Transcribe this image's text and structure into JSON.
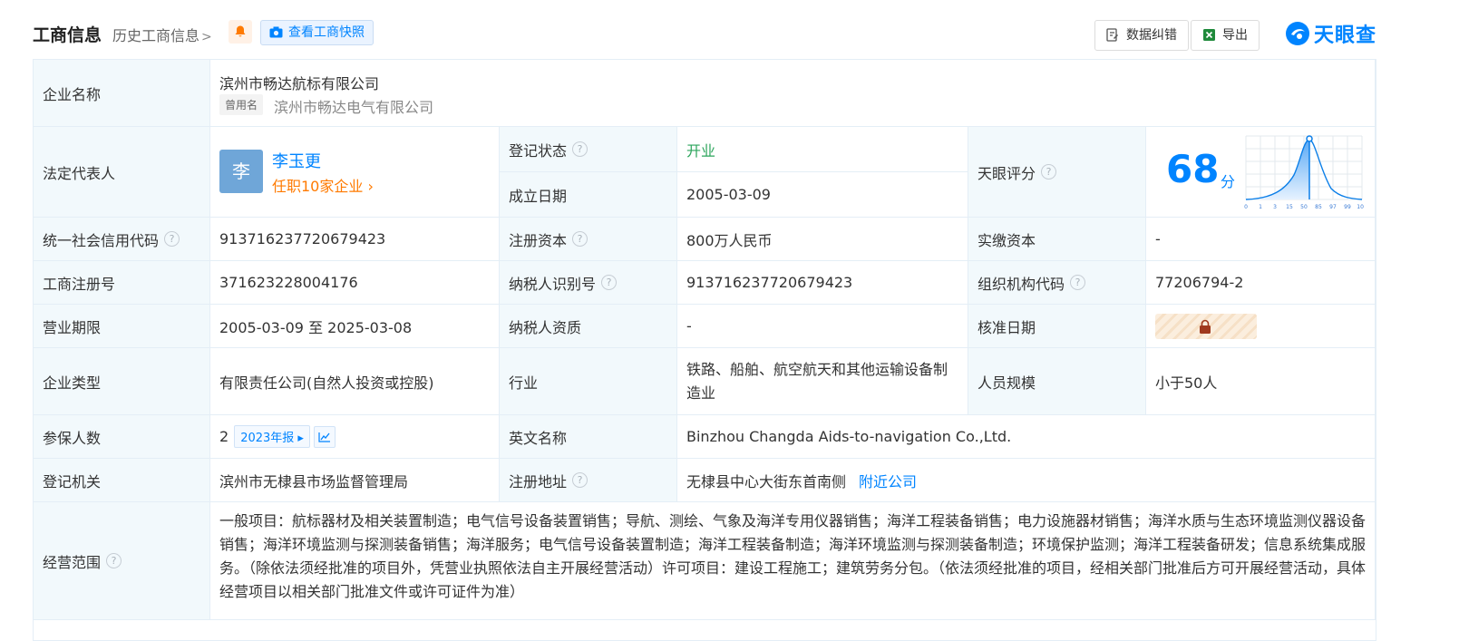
{
  "header": {
    "title": "工商信息",
    "history_link": "历史工商信息",
    "snapshot_button": "查看工商快照",
    "correct_button": "数据纠错",
    "export_button": "导出",
    "logo_text": "天眼查"
  },
  "rows": {
    "company_name_label": "企业名称",
    "company_name": "滨州市畅达航标有限公司",
    "former_name_tag": "曾用名",
    "former_name": "滨州市畅达电气有限公司",
    "legal_rep_label": "法定代表人",
    "legal_rep_avatar": "李",
    "legal_rep_name": "李玉更",
    "legal_rep_roles": "任职10家企业",
    "reg_status_label": "登记状态",
    "reg_status": "开业",
    "founded_label": "成立日期",
    "founded": "2005-03-09",
    "score_label": "天眼评分",
    "score": "68",
    "score_unit": "分",
    "credit_code_label": "统一社会信用代码",
    "credit_code": "913716237720679423",
    "reg_capital_label": "注册资本",
    "reg_capital": "800万人民币",
    "paid_capital_label": "实缴资本",
    "paid_capital": "-",
    "reg_no_label": "工商注册号",
    "reg_no": "371623228004176",
    "taxpayer_id_label": "纳税人识别号",
    "taxpayer_id": "913716237720679423",
    "org_code_label": "组织机构代码",
    "org_code": "77206794-2",
    "term_label": "营业期限",
    "term": "2005-03-09 至 2025-03-08",
    "taxpayer_qual_label": "纳税人资质",
    "taxpayer_qual": "-",
    "approval_date_label": "核准日期",
    "company_type_label": "企业类型",
    "company_type": "有限责任公司(自然人投资或控股)",
    "industry_label": "行业",
    "industry": "铁路、船舶、航空航天和其他运输设备制造业",
    "staff_size_label": "人员规模",
    "staff_size": "小于50人",
    "insured_label": "参保人数",
    "insured": "2",
    "insured_year": "2023年报",
    "english_name_label": "英文名称",
    "english_name": "Binzhou Changda Aids-to-navigation Co.,Ltd.",
    "authority_label": "登记机关",
    "authority": "滨州市无棣县市场监督管理局",
    "address_label": "注册地址",
    "address": "无棣县中心大街东首南侧",
    "nearby_link": "附近公司",
    "scope_label": "经营范围",
    "scope": "一般项目：航标器材及相关装置制造；电气信号设备装置销售；导航、测绘、气象及海洋专用仪器销售；海洋工程装备销售；电力设施器材销售；海洋水质与生态环境监测仪器设备销售；海洋环境监测与探测装备销售；海洋服务；电气信号设备装置制造；海洋工程装备制造；海洋环境监测与探测装备制造；环境保护监测；海洋工程装备研发；信息系统集成服务。（除依法须经批准的项目外，凭营业执照依法自主开展经营活动）许可项目：建设工程施工；建筑劳务分包。（依法须经批准的项目，经相关部门批准后方可开展经营活动，具体经营项目以相关部门批准文件或许可证件为准）"
  },
  "score_chart_ticks": [
    "0",
    "1",
    "3",
    "15",
    "50",
    "85",
    "97",
    "99",
    "100"
  ],
  "colors": {
    "accent": "#0084ff",
    "label_bg": "#f2f9fc",
    "orange": "#ff7a00",
    "green": "#2da55c"
  }
}
